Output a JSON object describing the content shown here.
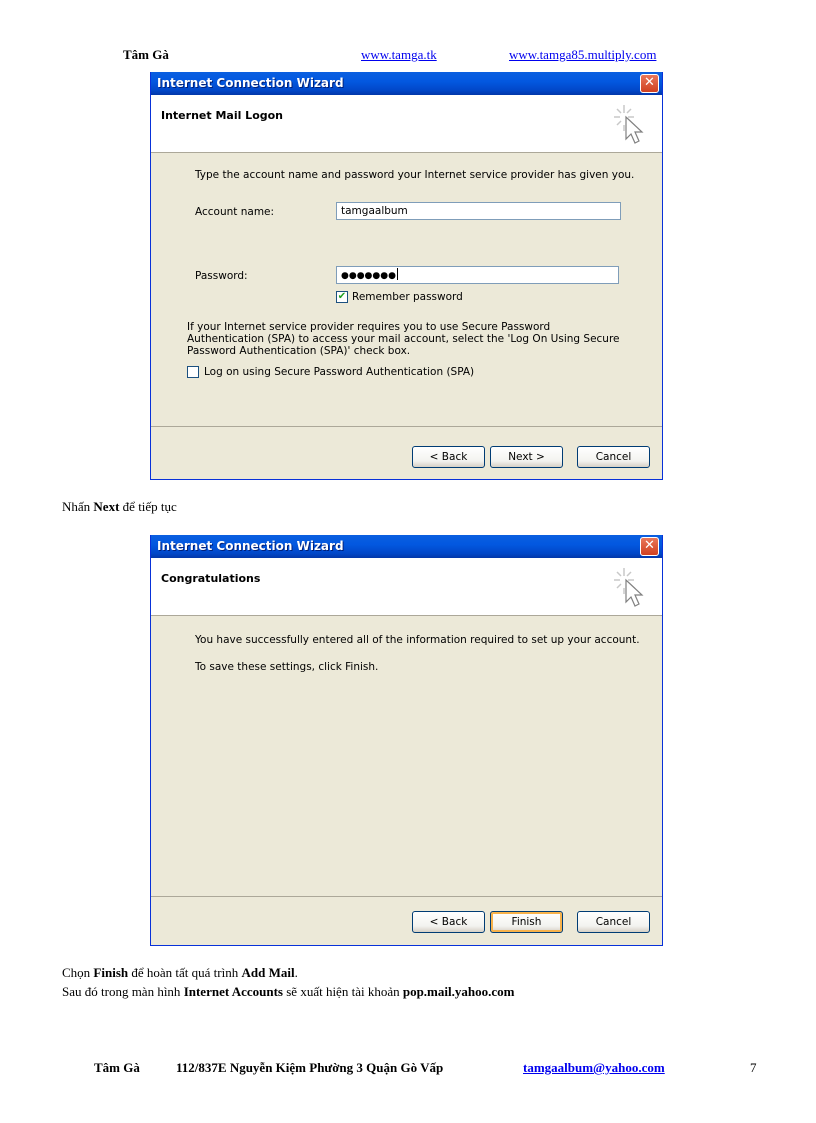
{
  "header": {
    "author": "Tâm Gà",
    "link1": "www.tamga.tk",
    "link2": "www.tamga85.multiply.com"
  },
  "wizard1": {
    "title": "Internet Connection Wizard",
    "close_label": "✕",
    "section_title": "Internet Mail Logon",
    "intro": "Type the account name and password your Internet service provider has given you.",
    "account_label": "Account name:",
    "account_value": "tamgaalbum",
    "password_label": "Password:",
    "password_value": "●●●●●●●",
    "remember_label": "Remember password",
    "remember_checked": "✔",
    "spa_text": "If your Internet service provider requires you to use Secure Password Authentication (SPA) to access your mail account, select the 'Log On Using Secure Password Authentication (SPA)' check box.",
    "spa_label": "Log on using Secure Password Authentication (SPA)",
    "back_label": "< Back",
    "next_label": "Next >",
    "cancel_label": "Cancel"
  },
  "step_text_1": {
    "before": "Nhấn ",
    "bold": "Next",
    "after": " để tiếp tục"
  },
  "wizard2": {
    "title": "Internet Connection Wizard",
    "close_label": "✕",
    "section_title": "Congratulations",
    "line1": "You have successfully entered all of the information required to set up your account.",
    "line2": "To save these settings, click Finish.",
    "back_label": "< Back",
    "finish_label": "Finish",
    "cancel_label": "Cancel"
  },
  "step_text_2": {
    "before": "Chọn ",
    "bold1": "Finish",
    "middle": " để hoàn tất quá trình ",
    "bold2": "Add Mail",
    "after": "."
  },
  "step_text_3": {
    "before": "Sau đó trong màn hình ",
    "bold1": "Internet Accounts",
    "middle": " sẽ xuất hiện tài khoản ",
    "bold2": "pop.mail.yahoo.com"
  },
  "footer": {
    "name": "Tâm Gà",
    "address": "112/837E Nguyễn Kiệm Phường 3 Quận Gò Vấp",
    "email": "tamgaalbum@yahoo.com",
    "page_number": "7"
  },
  "colors": {
    "titlebar": "#0358e0",
    "dialog_bg": "#ece9d8",
    "link": "#0000ee"
  }
}
